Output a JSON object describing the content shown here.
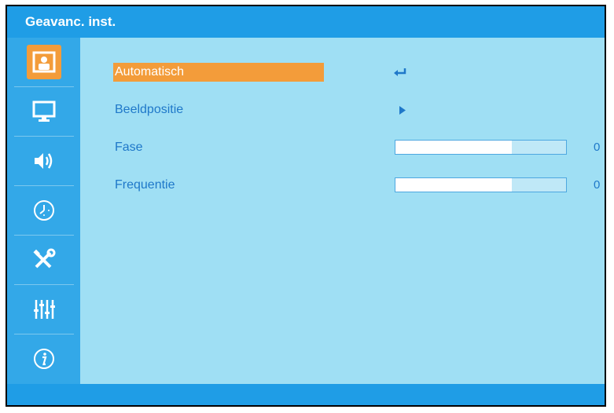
{
  "window": {
    "title": "Geavanc. inst."
  },
  "sidebar": {
    "items": [
      {
        "icon": "user-icon",
        "active": true
      },
      {
        "icon": "monitor-icon",
        "active": false
      },
      {
        "icon": "speaker-icon",
        "active": false
      },
      {
        "icon": "clock-icon",
        "active": false
      },
      {
        "icon": "tools-icon",
        "active": false
      },
      {
        "icon": "equalizer-icon",
        "active": false
      },
      {
        "icon": "info-icon",
        "active": false
      }
    ]
  },
  "menu": {
    "items": [
      {
        "label": "Automatisch",
        "selected": true,
        "control": "enter"
      },
      {
        "label": "Beeldpositie",
        "selected": false,
        "control": "arrow"
      },
      {
        "label": "Fase",
        "selected": false,
        "control": "slider",
        "fill": 0.68,
        "value": "0"
      },
      {
        "label": "Frequentie",
        "selected": false,
        "control": "slider",
        "fill": 0.68,
        "value": "0"
      }
    ]
  },
  "colors": {
    "title_bar": "#1f9de6",
    "sidebar": "#33a8e8",
    "background": "#9fdff4",
    "highlight": "#f39c3a",
    "text": "#1f78c9"
  }
}
